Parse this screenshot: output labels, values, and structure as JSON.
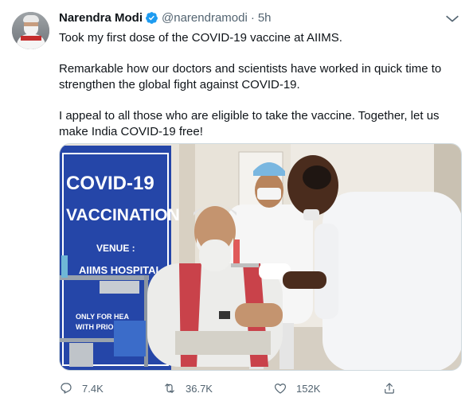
{
  "author": {
    "name": "Narendra Modi",
    "handle": "@narendramodi",
    "separator": "·",
    "time": "5h"
  },
  "tweet": {
    "paragraphs": [
      "Took my first dose of the COVID-19 vaccine at AIIMS.",
      "Remarkable how our doctors and scientists have worked in quick time to strengthen the global fight against COVID-19.",
      "I appeal to all those who are eligible to take the vaccine. Together, let us make India COVID-19 free!"
    ]
  },
  "media": {
    "banner_line1": "COVID-19",
    "banner_line2": "VACCINATION",
    "banner_venue": "VENUE :",
    "banner_hospital": "AIIMS HOSPITAL",
    "banner_cut": "OR",
    "banner_small1": "ONLY FOR HEA",
    "banner_small2": "WITH PRIOR",
    "banner_small_cut": "TI"
  },
  "actions": {
    "reply_count": "7.4K",
    "retweet_count": "36.7K",
    "like_count": "152K"
  },
  "colors": {
    "verified": "#1d9bf0",
    "secondary_text": "#536471",
    "banner_blue": "#2546a8"
  },
  "icons": [
    "verified-badge-icon",
    "more-icon",
    "reply-icon",
    "retweet-icon",
    "like-icon",
    "share-icon"
  ]
}
